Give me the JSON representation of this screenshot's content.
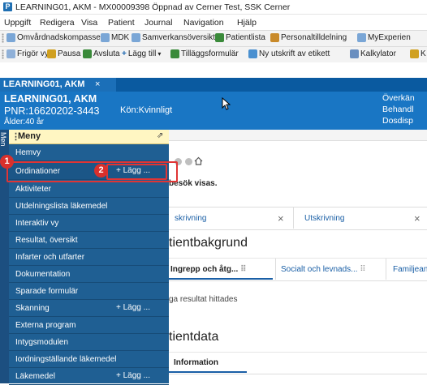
{
  "window": {
    "title": "LEARNING01, AKM - MX00009398 Öppnad av Cerner Test, SSK Cerner",
    "app_icon": "P"
  },
  "menubar": [
    "Uppgift",
    "Redigera",
    "Visa",
    "Patient",
    "Journal",
    "Navigation",
    "Hjälp"
  ],
  "toolbar1": [
    "Omvårdnadskompassen",
    "MDK",
    "Samverkansöversikt",
    "Patientlista",
    "Personaltilldelning",
    "MyExperien"
  ],
  "toolbar2": [
    "Frigör vy",
    "Pausa",
    "Avsluta",
    "Lägg till",
    "Tilläggsformulär",
    "Ny utskrift av etikett",
    "Kalkylator",
    "K"
  ],
  "patient_tab": {
    "label": "LEARNING01, AKM",
    "close": "×"
  },
  "banner": {
    "name": "LEARNING01, AKM",
    "pnr": "PNR:16620202-3443",
    "age": "Ålder:40 år",
    "kon": "Kön:Kvinnligt",
    "right": [
      "Överkän",
      "Behandl",
      "Dosdisp"
    ]
  },
  "side_strip": "Men",
  "menu": {
    "header": "Meny",
    "pin": "⇗",
    "items": [
      {
        "label": "Hemvy",
        "add": ""
      },
      {
        "label": "Ordinationer",
        "add": "+ Lägg ..."
      },
      {
        "label": "Aktiviteter",
        "add": ""
      },
      {
        "label": "Utdelningslista läkemedel",
        "add": ""
      },
      {
        "label": "Interaktiv vy",
        "add": ""
      },
      {
        "label": "Resultat, översikt",
        "add": ""
      },
      {
        "label": "Infarter och utfarter",
        "add": ""
      },
      {
        "label": "Dokumentation",
        "add": ""
      },
      {
        "label": "Sparade formulär",
        "add": ""
      },
      {
        "label": "Skanning",
        "add": "+ Lägg ..."
      },
      {
        "label": "Externa program",
        "add": ""
      },
      {
        "label": "Intygsmodulen",
        "add": ""
      },
      {
        "label": "Iordningställande läkemedel",
        "add": ""
      },
      {
        "label": "Läkemedel",
        "add": "+ Lägg ..."
      }
    ]
  },
  "content": {
    "visit_note": "besök visas.",
    "tabs": [
      "skrivning",
      "Utskrivning"
    ],
    "tab_close": "×",
    "section1": "tientbakgrund",
    "subtabs": [
      "Ingrepp och åtg...",
      "Socialt och levnads...",
      "Familjean"
    ],
    "subtab_icon": "⠿",
    "no_results": "ga resultat hittades",
    "section2": "tientdata",
    "info_tab": "Information"
  },
  "annotations": {
    "one": "1",
    "two": "2"
  },
  "colors": {
    "banner": "#1976c4",
    "menu": "#1f5f93",
    "menu_header": "#fff6c2",
    "annotation": "#d9302c"
  }
}
